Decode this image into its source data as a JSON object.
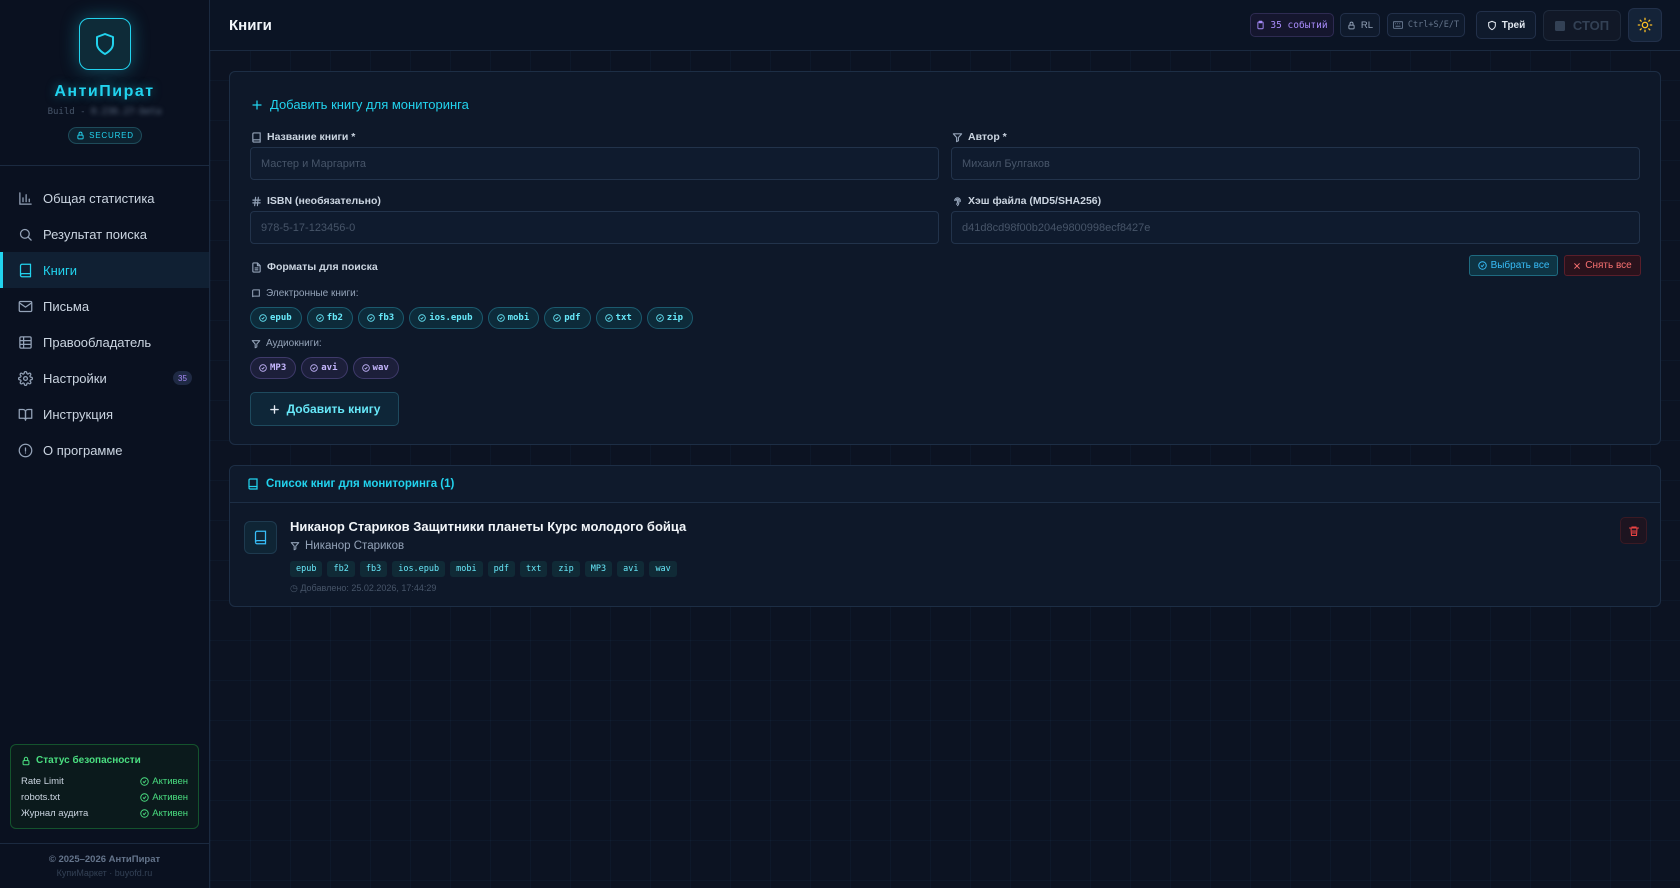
{
  "app": {
    "name": "АнтиПират",
    "build_prefix": "Build -",
    "build_version": "0.236.27-beta",
    "secured_badge": "SECURED"
  },
  "sidebar": {
    "items": [
      {
        "label": "Общая статистика",
        "icon": "bar-chart-icon"
      },
      {
        "label": "Результат поиска",
        "icon": "search-icon"
      },
      {
        "label": "Книги",
        "icon": "book-icon",
        "active": true
      },
      {
        "label": "Письма",
        "icon": "mail-icon"
      },
      {
        "label": "Правообладатель",
        "icon": "table-icon"
      },
      {
        "label": "Настройки",
        "icon": "gear-icon",
        "badge": "35"
      },
      {
        "label": "Инструкция",
        "icon": "book-open-icon"
      },
      {
        "label": "О программе",
        "icon": "info-icon"
      }
    ],
    "security": {
      "title": "Статус безопасности",
      "rows": [
        {
          "key": "Rate Limit",
          "value": "Активен"
        },
        {
          "key": "robots.txt",
          "value": "Активен"
        },
        {
          "key": "Журнал аудита",
          "value": "Активен"
        }
      ]
    },
    "footer": {
      "copyright": "© 2025–2026 АнтиПират",
      "site": "КупиМаркет · buyofd.ru"
    }
  },
  "topbar": {
    "title": "Книги",
    "events": "35 событий",
    "rl": "RL",
    "shortcut": "Ctrl+S/E/T",
    "tray": "Трей",
    "stop": "СТОП"
  },
  "form": {
    "title": "Добавить книгу для мониторинга",
    "book_name_label": "Название книги *",
    "book_name_placeholder": "Мастер и Маргарита",
    "author_label": "Автор *",
    "author_placeholder": "Михаил Булгаков",
    "isbn_label": "ISBN (необязательно)",
    "isbn_placeholder": "978-5-17-123456-0",
    "hash_label": "Хэш файла (MD5/SHA256)",
    "hash_placeholder": "d41d8cd98f00b204e9800998ecf8427e",
    "formats_label": "Форматы для поиска",
    "select_all": "Выбрать все",
    "deselect_all": "Снять все",
    "ebooks_label": "Электронные книги:",
    "ebook_formats": [
      "epub",
      "fb2",
      "fb3",
      "ios.epub",
      "mobi",
      "pdf",
      "txt",
      "zip"
    ],
    "audio_label": "Аудиокниги:",
    "audio_formats": [
      "MP3",
      "avi",
      "wav"
    ],
    "submit": "Добавить книгу"
  },
  "list": {
    "title": "Список книг для мониторинга (1)",
    "books": [
      {
        "title": "Никанор Стариков Защитники планеты Курс молодого бойца",
        "author": "Никанор Стариков",
        "formats": [
          "epub",
          "fb2",
          "fb3",
          "ios.epub",
          "mobi",
          "pdf",
          "txt",
          "zip",
          "MP3",
          "avi",
          "wav"
        ],
        "added": "Добавлено: 25.02.2026, 17:44:29"
      }
    ]
  },
  "colors": {
    "accent": "#22d3ee",
    "success": "#4ade80",
    "danger": "#f87171",
    "purple": "#a78bfa"
  }
}
